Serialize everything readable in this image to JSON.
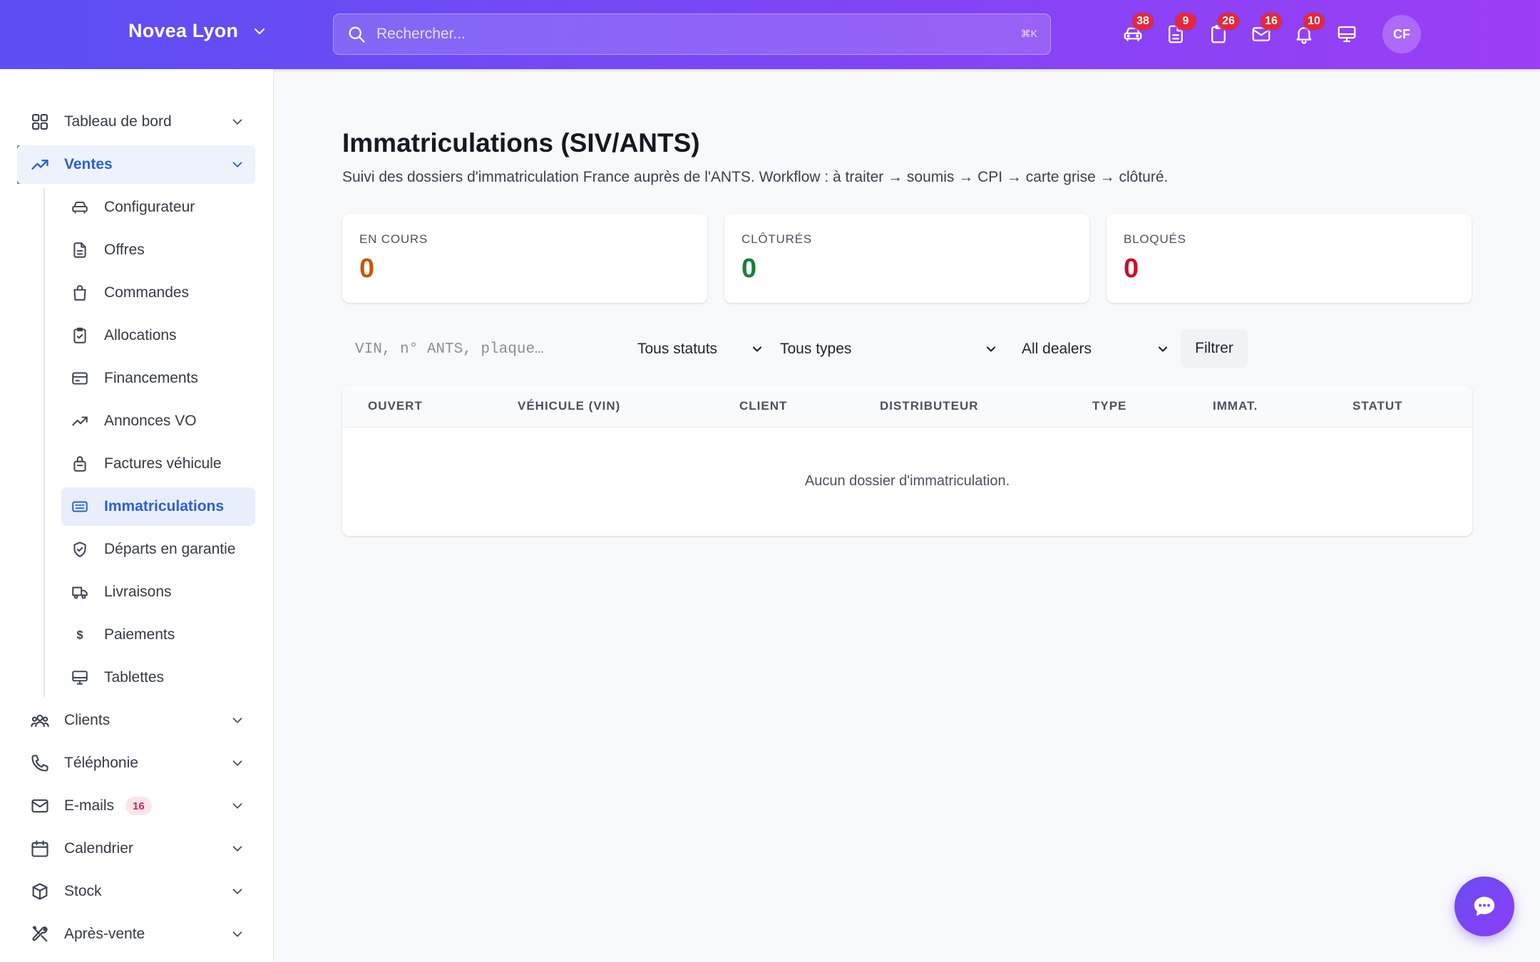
{
  "header": {
    "brand": "Novea Lyon",
    "search_placeholder": "Rechercher...",
    "search_shortcut": "⌘K",
    "icons": [
      {
        "name": "car-icon",
        "badge": "38"
      },
      {
        "name": "document-icon",
        "badge": "9"
      },
      {
        "name": "clipboard-icon",
        "badge": "26"
      },
      {
        "name": "mail-icon",
        "badge": "16"
      },
      {
        "name": "bell-icon",
        "badge": "10"
      },
      {
        "name": "monitor-icon",
        "badge": ""
      }
    ],
    "avatar": "CF"
  },
  "sidebar": {
    "tableau": "Tableau de bord",
    "ventes": "Ventes",
    "sub": [
      "Configurateur",
      "Offres",
      "Commandes",
      "Allocations",
      "Financements",
      "Annonces VO",
      "Factures véhicule",
      "Immatriculations",
      "Départs en garantie",
      "Livraisons",
      "Paiements",
      "Tablettes"
    ],
    "clients": "Clients",
    "telephonie": "Téléphonie",
    "emails": "E-mails",
    "emails_count": "16",
    "calendrier": "Calendrier",
    "stock": "Stock",
    "apres_vente": "Après-vente"
  },
  "main": {
    "title": "Immatriculations (SIV/ANTS)",
    "subtitle": "Suivi des dossiers d'immatriculation France auprès de l'ANTS. Workflow : à traiter → soumis → CPI → carte grise → clôturé.",
    "stats": [
      {
        "label": "EN COURS",
        "value": "0",
        "color": "#c25a0a"
      },
      {
        "label": "CLÔTURÉS",
        "value": "0",
        "color": "#17803d"
      },
      {
        "label": "BLOQUÉS",
        "value": "0",
        "color": "#c8102e"
      }
    ],
    "filters": {
      "search_placeholder": "VIN, n° ANTS, plaque…",
      "status": "Tous statuts",
      "type": "Tous types",
      "dealer": "All dealers",
      "button": "Filtrer"
    },
    "table": {
      "columns": [
        "OUVERT",
        "VÉHICULE (VIN)",
        "CLIENT",
        "DISTRIBUTEUR",
        "TYPE",
        "IMMAT.",
        "STATUT"
      ],
      "empty": "Aucun dossier d'immatriculation."
    }
  }
}
